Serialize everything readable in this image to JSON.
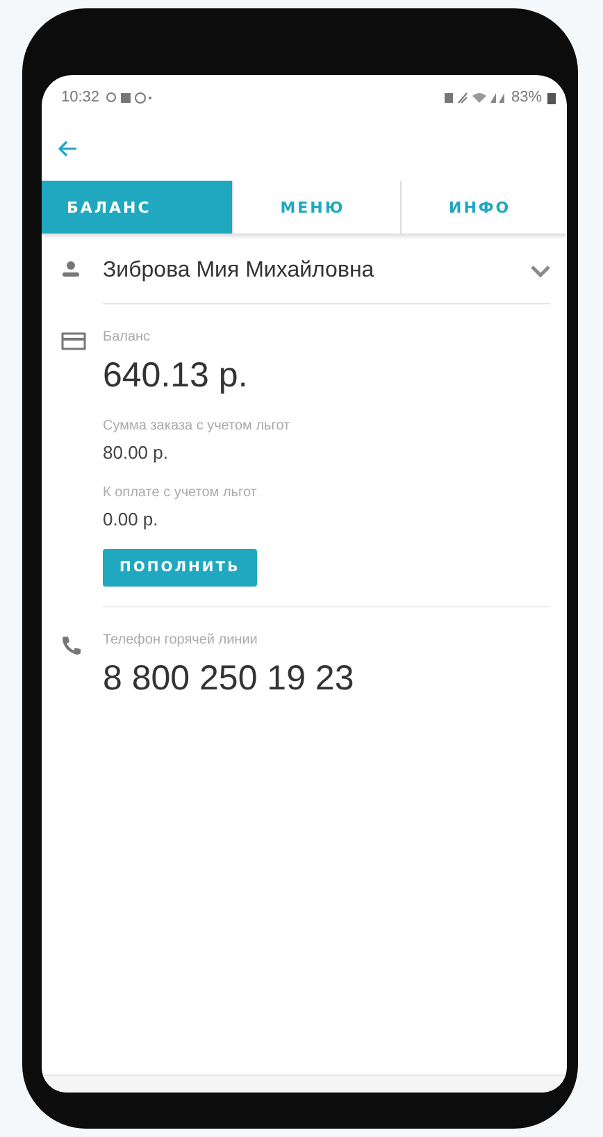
{
  "status_bar": {
    "time": "10:32",
    "battery": "83%"
  },
  "tabs": [
    {
      "label": "БАЛАНС",
      "selected": true
    },
    {
      "label": "МЕНЮ",
      "selected": false
    },
    {
      "label": "ИНФО",
      "selected": false
    }
  ],
  "user": {
    "name": "Зиброва Мия Михайловна",
    "expanded": false
  },
  "balance": {
    "label": "Баланс",
    "amount": "640.13 р.",
    "details": [
      {
        "label": "Сумма заказа с учетом льгот",
        "value": "80.00 р."
      },
      {
        "label": "К оплате с учетом льгот",
        "value": "0.00 р."
      }
    ],
    "button": "ПОПОЛНИТЬ"
  },
  "hotline": {
    "label": "Телефон горячей линии",
    "phone": "8 800 250 19 23"
  }
}
